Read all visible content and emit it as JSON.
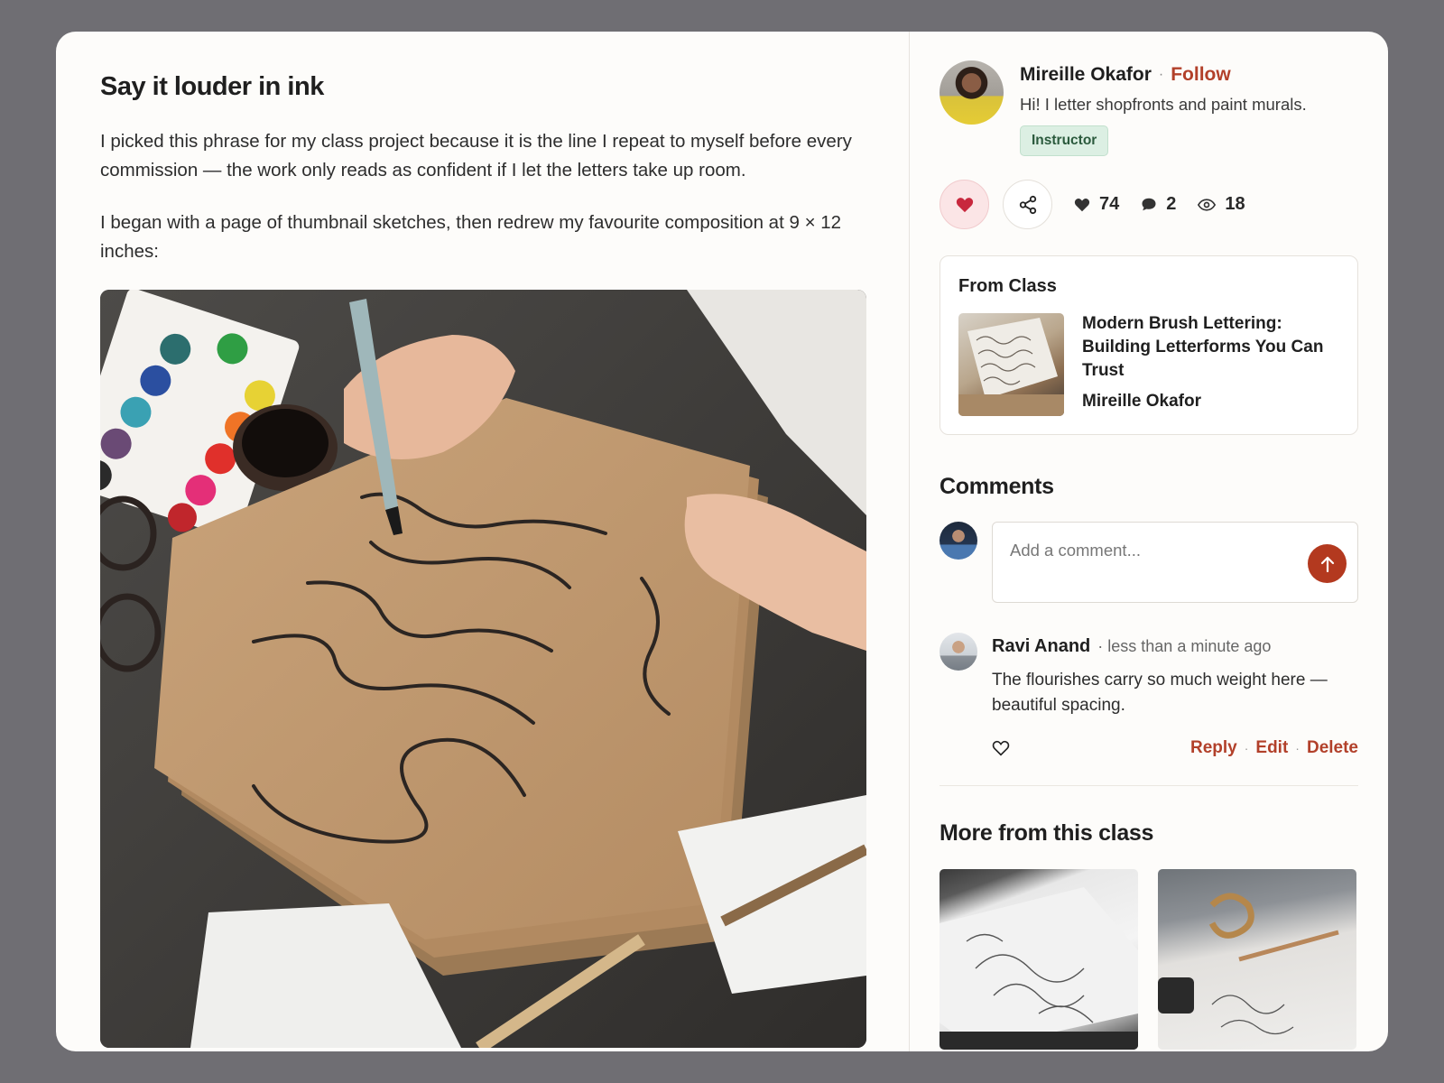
{
  "post": {
    "title": "Say it louder in ink",
    "paragraphs": [
      "I picked this phrase for my class project because it is the line I repeat to myself before every commission — the work only reads as confident if I let the letters take up room.",
      "I began with a page of thumbnail sketches, then redrew my favourite composition at 9 × 12 inches:"
    ],
    "hero_image_alt": "Hand lettering with a brush pen on kraft paper",
    "hero_lettering": [
      "There is",
      "a light",
      "that",
      "never",
      "goes out"
    ]
  },
  "author": {
    "name": "Mireille Okafor",
    "follow_label": "Follow",
    "bio": "Hi! I letter shopfronts and paint murals.",
    "badge": "Instructor",
    "separator": "·"
  },
  "stats": {
    "likes": "74",
    "comments": "2",
    "views": "18"
  },
  "from_class": {
    "heading": "From Class",
    "title": "Modern Brush Lettering: Building Letterforms You Can Trust",
    "author": "Mireille Okafor"
  },
  "comments": {
    "heading": "Comments",
    "placeholder": "Add a comment...",
    "items": [
      {
        "author": "Ravi Anand",
        "time": "· less than a minute ago",
        "text": "The flourishes carry so much weight here — beautiful spacing.",
        "reply": "Reply",
        "edit": "Edit",
        "delete": "Delete"
      }
    ],
    "sep": "·"
  },
  "more": {
    "heading": "More from this class"
  },
  "colors": {
    "accent": "#b2402a",
    "badge_bg": "#dcefe3",
    "like_bg": "#fbe5e6",
    "heart": "#c8283d"
  }
}
